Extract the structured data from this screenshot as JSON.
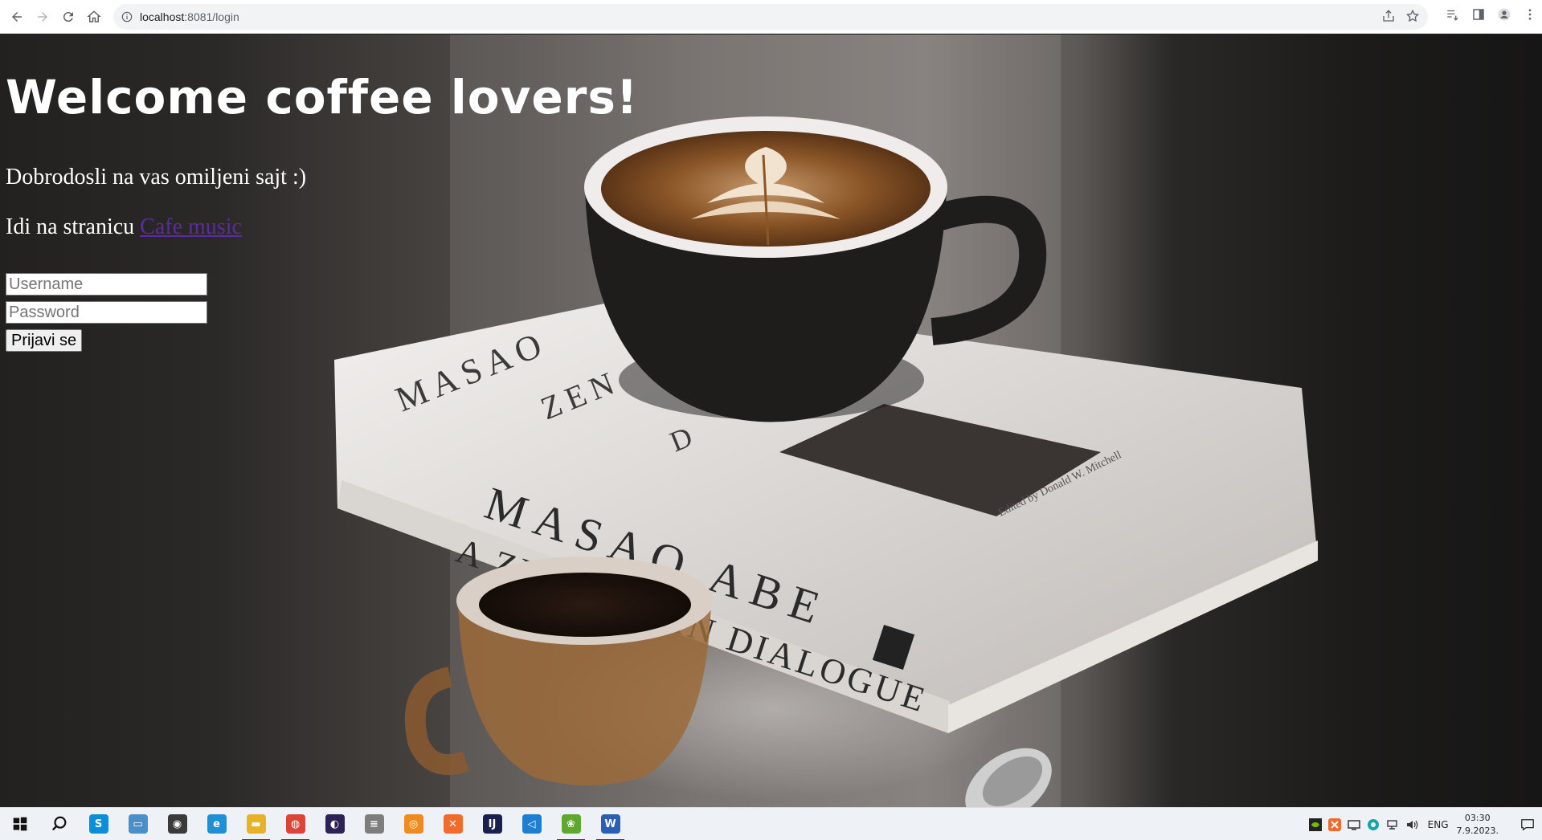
{
  "browser": {
    "url_host": "localhost",
    "url_rest": ":8081/login"
  },
  "page": {
    "heading": "Welcome coffee lovers!",
    "subtitle": "Dobrodosli na vas omiljeni sajt :)",
    "nav_prefix": "Idi na stranicu ",
    "nav_link": "Cafe music",
    "username_placeholder": "Username",
    "password_placeholder": "Password",
    "submit_label": "Prijavi se",
    "link_color": "#5b2ca0"
  },
  "book": {
    "spine_line1": "MASAO ABE",
    "spine_line2": "A ZEN LIFE IN DIALOGUE",
    "cover_line1": "MASAO",
    "cover_line2": "ZEN",
    "cover_line3": "D",
    "editor": "Edited by Donald W. Mitchell"
  },
  "taskbar": {
    "apps": [
      {
        "name": "windows-start",
        "icon": "windows-logo-icon"
      },
      {
        "name": "search",
        "icon": "search-icon"
      },
      {
        "name": "skype",
        "icon": "skype-icon",
        "glyph": "S",
        "color": "#0b8fd9"
      },
      {
        "name": "computer",
        "icon": "monitor-icon",
        "glyph": "▭",
        "color": "#4a8fc7"
      },
      {
        "name": "camera-app",
        "icon": "camera-icon",
        "glyph": "◉",
        "color": "#3a3a3a"
      },
      {
        "name": "edge",
        "icon": "edge-icon",
        "glyph": "e",
        "color": "#1f8fd6"
      },
      {
        "name": "file-explorer",
        "icon": "folder-icon",
        "glyph": "▬",
        "color": "#e8b12a",
        "active": true
      },
      {
        "name": "chrome",
        "icon": "chrome-icon",
        "glyph": "◍",
        "color": "#db4437",
        "active": true
      },
      {
        "name": "eclipse",
        "icon": "eclipse-icon",
        "glyph": "◐",
        "color": "#2c2255"
      },
      {
        "name": "database",
        "icon": "database-icon",
        "glyph": "≡",
        "color": "#7d7d7d"
      },
      {
        "name": "blender",
        "icon": "blender-icon",
        "glyph": "◎",
        "color": "#f08c1f"
      },
      {
        "name": "xampp",
        "icon": "xampp-icon",
        "glyph": "✕",
        "color": "#f26b2b"
      },
      {
        "name": "intellij",
        "icon": "intellij-icon",
        "glyph": "IJ",
        "color": "#1b1f50"
      },
      {
        "name": "vscode",
        "icon": "vscode-icon",
        "glyph": "◁",
        "color": "#1d7fd2"
      },
      {
        "name": "spring",
        "icon": "spring-icon",
        "glyph": "❀",
        "color": "#5fa82f",
        "active": true
      },
      {
        "name": "word",
        "icon": "word-icon",
        "glyph": "W",
        "color": "#2b5eb5",
        "active": true
      }
    ],
    "tray": {
      "language": "ENG",
      "time": "03:30",
      "date": "7.9.2023."
    }
  }
}
